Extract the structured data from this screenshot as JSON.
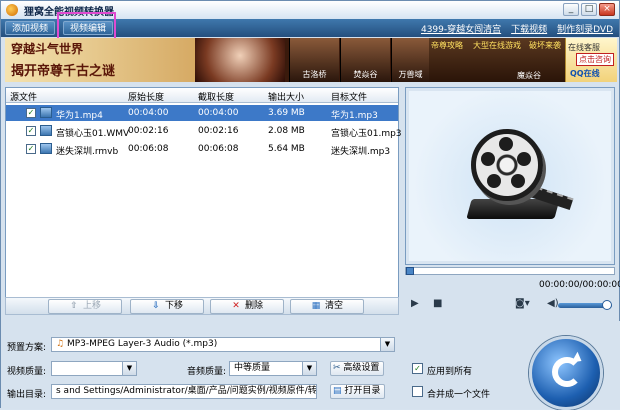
{
  "window": {
    "title": "狸窝全能视频转换器"
  },
  "toolbar": {
    "add_video": "添加视频",
    "video_edit": "视频编辑",
    "links": [
      "4399-穿越女闯清宫",
      "下载视频",
      "制作刻录DVD"
    ]
  },
  "banner": {
    "line1": "穿越斗气世界",
    "line2": "揭开帝尊千古之谜",
    "thumbs": [
      "古洛桥",
      "焚焱谷",
      "万兽域",
      "魔焱谷"
    ],
    "ad_lines": [
      "帝尊攻略",
      "大型在线游戏",
      "破坏来袭"
    ],
    "service_label": "在线客服",
    "service_click": "点击咨询",
    "qq_online": "QQ在线"
  },
  "file_table": {
    "columns": [
      "源文件",
      "原始长度",
      "截取长度",
      "输出大小",
      "目标文件"
    ],
    "rows": [
      {
        "name": "华为1.mp4",
        "orig": "00:04:00",
        "cut": "00:04:00",
        "size": "3.69 MB",
        "target": "华为1.mp3",
        "selected": true
      },
      {
        "name": "宫锁心玉01.WMV",
        "orig": "00:02:16",
        "cut": "00:02:16",
        "size": "2.08 MB",
        "target": "宫锁心玉01.mp3",
        "selected": false
      },
      {
        "name": "迷失深圳.rmvb",
        "orig": "00:06:08",
        "cut": "00:06:08",
        "size": "5.64 MB",
        "target": "迷失深圳.mp3",
        "selected": false
      }
    ]
  },
  "list_buttons": {
    "up": "上移",
    "down": "下移",
    "delete": "删除",
    "clear": "清空"
  },
  "player": {
    "time": "00:00:00/00:00:00"
  },
  "settings": {
    "preset_label": "预置方案:",
    "preset_value": "MP3-MPEG Layer-3 Audio (*.mp3)",
    "video_quality_label": "视频质量:",
    "video_quality_value": "",
    "audio_quality_label": "音频质量:",
    "audio_quality_value": "中等质量",
    "advanced": "高级设置",
    "apply_all": "应用到所有",
    "output_label": "输出目录:",
    "output_path": "s and Settings/Administrator/桌面/产品/问题实例/视频原件/转换",
    "open_dir": "打开目录",
    "merge": "合并成一个文件"
  }
}
